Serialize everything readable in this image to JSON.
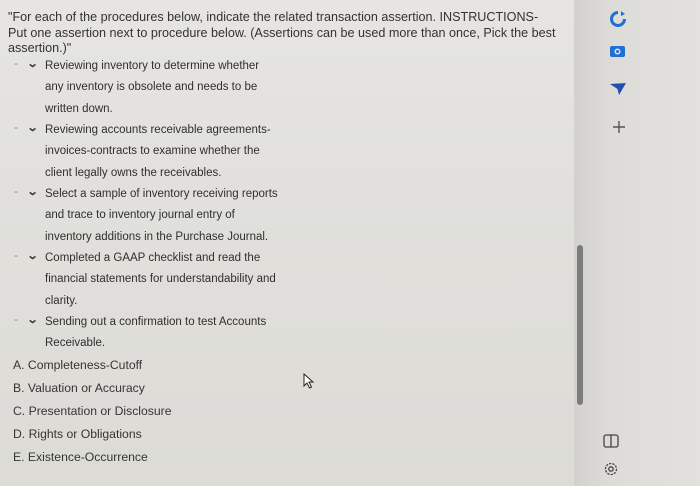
{
  "question": {
    "text": "\"For each of the procedures below, indicate the related transaction assertion. INSTRUCTIONS- Put one assertion next to procedure below. (Assertions can be used more than once, Pick the best assertion.)\""
  },
  "procedures": [
    {
      "dash": "-",
      "lines": [
        "Reviewing inventory to determine whether",
        "any inventory is obsolete and needs to be",
        "written down."
      ]
    },
    {
      "dash": "-",
      "lines": [
        "Reviewing accounts receivable agreements-",
        "invoices-contracts to examine whether the",
        "client legally owns the receivables."
      ]
    },
    {
      "dash": "-",
      "lines": [
        "Select a sample of inventory receiving reports",
        "and trace to inventory journal entry of",
        "inventory additions in the Purchase Journal."
      ]
    },
    {
      "dash": "-",
      "lines": [
        "Completed a GAAP checklist and read the",
        "financial statements for understandability and",
        "clarity."
      ]
    },
    {
      "dash": "-",
      "lines": [
        "Sending out a confirmation to test Accounts",
        "Receivable."
      ]
    }
  ],
  "options": [
    "A. Completeness-Cutoff",
    "B. Valuation or Accuracy",
    "C. Presentation or Disclosure",
    "D. Rights or Obligations",
    "E. Existence-Occurrence"
  ],
  "rail_icons": [
    "refresh-icon",
    "camera-icon",
    "send-icon",
    "plus-icon",
    "copy-icon",
    "settings-icon"
  ],
  "colors": {
    "accent_blue": "#1f6fd8",
    "text": "#2f2f2f",
    "background": "#e2e1dd"
  }
}
